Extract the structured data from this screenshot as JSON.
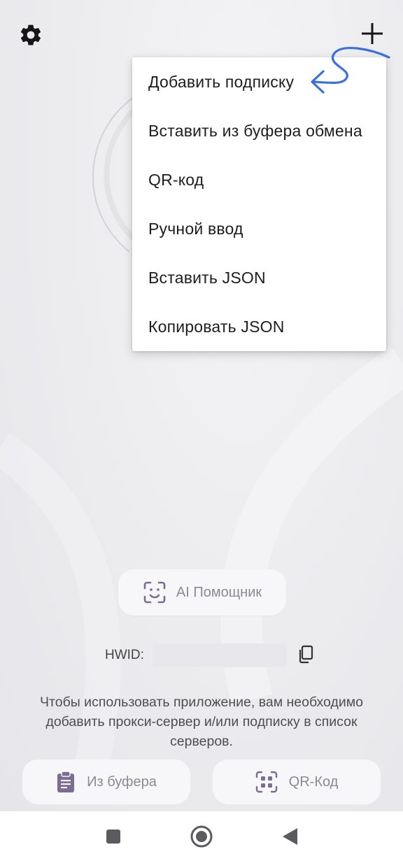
{
  "topbar": {
    "settings_icon": "gear-icon",
    "add_icon": "plus-icon"
  },
  "menu": {
    "items": [
      {
        "label": "Добавить подписку"
      },
      {
        "label": "Вставить из буфера обмена"
      },
      {
        "label": "QR-код"
      },
      {
        "label": "Ручной ввод"
      },
      {
        "label": "Вставить JSON"
      },
      {
        "label": "Копировать JSON"
      }
    ]
  },
  "assistant": {
    "label": "AI Помощник",
    "icon": "face-scan-icon"
  },
  "hwid": {
    "label": "HWID:",
    "icon": "copy-icon"
  },
  "hint": {
    "text": "Чтобы использовать приложение, вам необходимо добавить прокси-сервер и/или подписку в список серверов."
  },
  "actions": {
    "clipboard_label": "Из буфера",
    "clipboard_icon": "clipboard-icon",
    "qr_label": "QR-Код",
    "qr_icon": "qr-scan-icon"
  },
  "colors": {
    "annotation_arrow": "#3a6fe0",
    "icon_accent": "#7a6c93"
  },
  "navbar": {
    "recent_icon": "square-icon",
    "home_icon": "circle-home-icon",
    "back_icon": "triangle-back-icon"
  }
}
